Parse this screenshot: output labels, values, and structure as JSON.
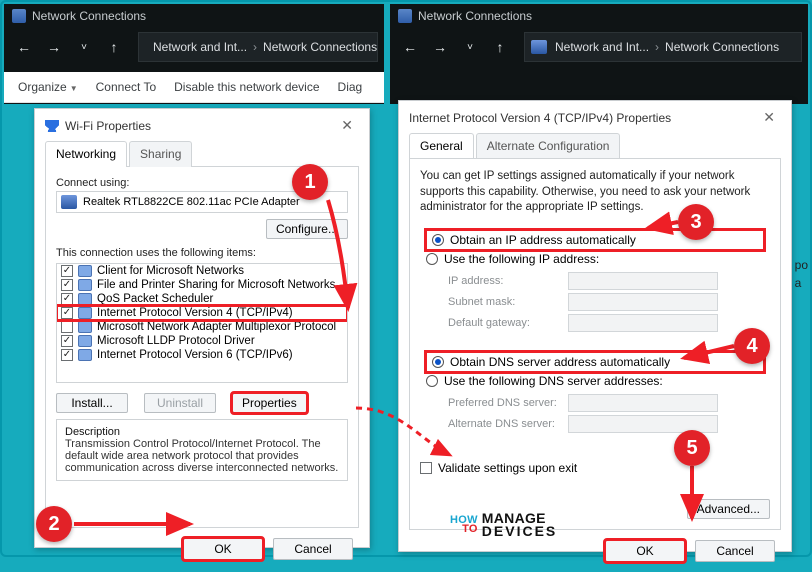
{
  "explorer": {
    "title": "Network Connections",
    "crumb1": "Network and Int...",
    "crumb2": "Network Connections",
    "toolbar": {
      "organize": "Organize",
      "connect": "Connect To",
      "disable": "Disable this network device",
      "diag": "Diag"
    }
  },
  "wifi": {
    "title": "Wi-Fi Properties",
    "tab_net": "Networking",
    "tab_share": "Sharing",
    "connect_using": "Connect using:",
    "adapter": "Realtek RTL8822CE 802.11ac PCIe Adapter",
    "configure": "Configure...",
    "uses_items": "This connection uses the following items:",
    "items": [
      "Client for Microsoft Networks",
      "File and Printer Sharing for Microsoft Networks",
      "QoS Packet Scheduler",
      "Internet Protocol Version 4 (TCP/IPv4)",
      "Microsoft Network Adapter Multiplexor Protocol",
      "Microsoft LLDP Protocol Driver",
      "Internet Protocol Version 6 (TCP/IPv6)"
    ],
    "install": "Install...",
    "uninstall": "Uninstall",
    "properties": "Properties",
    "desc_h": "Description",
    "desc": "Transmission Control Protocol/Internet Protocol. The default wide area network protocol that provides communication across diverse interconnected networks.",
    "ok": "OK",
    "cancel": "Cancel"
  },
  "ipv4": {
    "title": "Internet Protocol Version 4 (TCP/IPv4) Properties",
    "tab_gen": "General",
    "tab_alt": "Alternate Configuration",
    "info": "You can get IP settings assigned automatically if your network supports this capability. Otherwise, you need to ask your network administrator for the appropriate IP settings.",
    "auto_ip": "Obtain an IP address automatically",
    "use_ip": "Use the following IP address:",
    "ip_addr": "IP address:",
    "subnet": "Subnet mask:",
    "gateway": "Default gateway:",
    "auto_dns": "Obtain DNS server address automatically",
    "use_dns": "Use the following DNS server addresses:",
    "pref_dns": "Preferred DNS server:",
    "alt_dns": "Alternate DNS server:",
    "validate": "Validate settings upon exit",
    "advanced": "Advanced...",
    "ok": "OK",
    "cancel": "Cancel"
  },
  "partial": {
    "po": "po",
    "a": "a"
  },
  "logo": {
    "how": "HOW",
    "to": "TO",
    "manage": "MANAGE",
    "devices": "DEVICES"
  }
}
